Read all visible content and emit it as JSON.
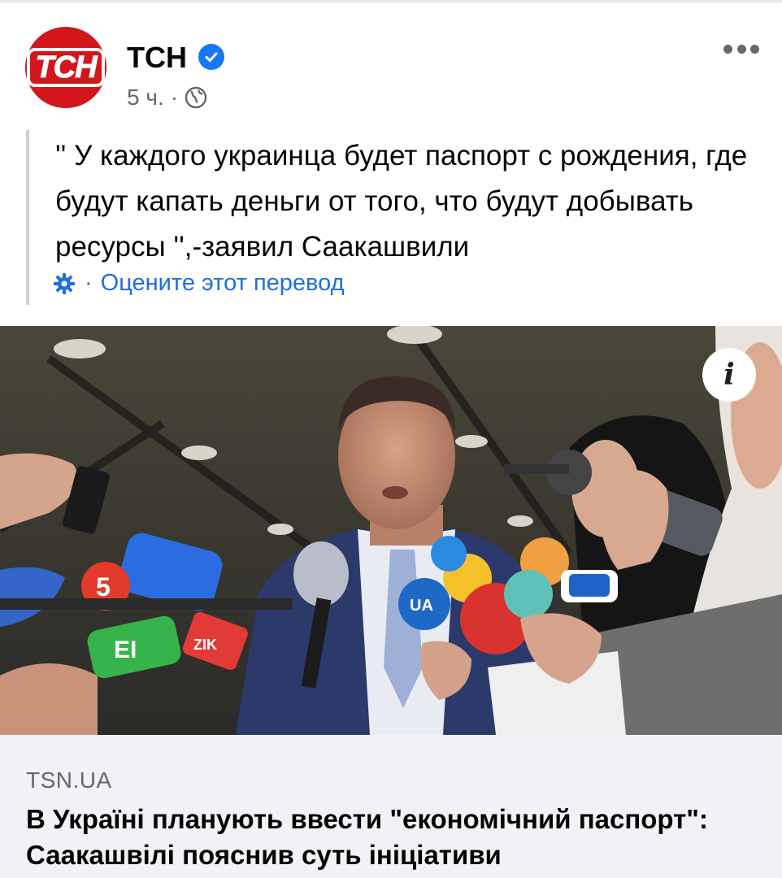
{
  "post": {
    "page_name": "ТСН",
    "avatar_text": "ТСН",
    "timestamp": "5 ч.",
    "separator": "·",
    "text": "'' У каждого украинца будет паспорт с рождения, где будут капать деньги от того, что будут добывать ресурсы '',-заявил Саакашвили",
    "translate_separator": "·",
    "translate_label": "Оцените этот перевод"
  },
  "icons": {
    "verified": "verified-check-icon",
    "globe": "globe-icon",
    "more": "more-options-icon",
    "settings": "gear-icon",
    "info": "info-icon"
  },
  "photo": {
    "info_glyph": "i",
    "mic_labels": [
      "5",
      "ZIK",
      "UA",
      "EI"
    ]
  },
  "link": {
    "domain": "TSN.UA",
    "title": "В Україні планують ввести \"економічний паспорт\": Саакашвілі пояснив суть ініціативи"
  },
  "colors": {
    "brand_red": "#d2161c",
    "verified_blue": "#1877f2",
    "link_blue": "#216fdb",
    "meta_gray": "#65676b",
    "preview_bg": "#f0f2f5"
  }
}
